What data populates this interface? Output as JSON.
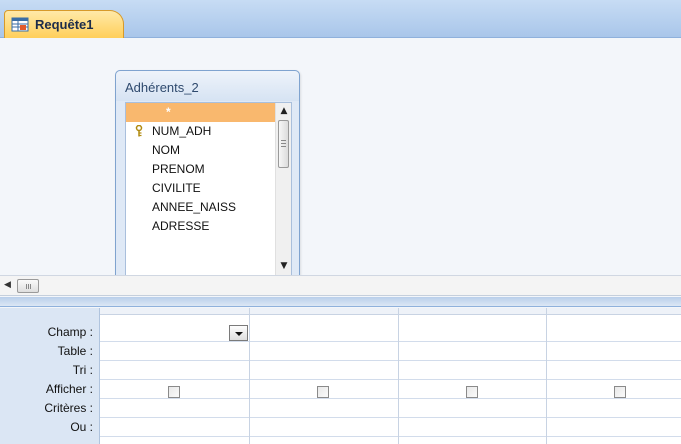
{
  "tab": {
    "label": "Requête1",
    "icon": "query-icon"
  },
  "field_list": {
    "title": "Adhérents_2",
    "items": [
      {
        "label": "*",
        "selected": true
      },
      {
        "label": "NUM_ADH",
        "key": true
      },
      {
        "label": "NOM"
      },
      {
        "label": "PRENOM"
      },
      {
        "label": "CIVILITE"
      },
      {
        "label": "ANNEE_NAISS"
      },
      {
        "label": "ADRESSE"
      }
    ]
  },
  "grid": {
    "row_labels": {
      "champ": "Champ :",
      "table": "Table :",
      "tri": "Tri :",
      "afficher": "Afficher :",
      "criteres": "Critères :",
      "ou": "Ou :"
    },
    "columns": [
      {
        "champ": "",
        "table": "",
        "tri": "",
        "afficher": false,
        "criteres": "",
        "ou": ""
      },
      {
        "champ": "",
        "table": "",
        "tri": "",
        "afficher": false,
        "criteres": "",
        "ou": ""
      },
      {
        "champ": "",
        "table": "",
        "tri": "",
        "afficher": false,
        "criteres": "",
        "ou": ""
      },
      {
        "champ": "",
        "table": "",
        "tri": "",
        "afficher": false,
        "criteres": "",
        "ou": ""
      }
    ]
  },
  "colors": {
    "tab_active": "#ffcf5a",
    "selection": "#f9b86e",
    "pane_background": "#f3f6fa",
    "grid_labels": "#dbe6f4"
  }
}
